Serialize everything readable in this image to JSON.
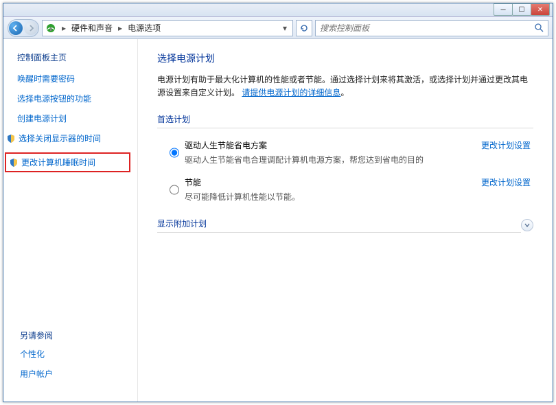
{
  "breadcrumb": {
    "seg1": "硬件和声音",
    "seg2": "电源选项"
  },
  "search": {
    "placeholder": "搜索控制面板"
  },
  "sidebar": {
    "title": "控制面板主页",
    "links": {
      "l0": "唤醒时需要密码",
      "l1": "选择电源按钮的功能",
      "l2": "创建电源计划",
      "l3": "选择关闭显示器的时间",
      "l4": "更改计算机睡眠时间"
    },
    "see_also": "另请参阅",
    "bottom": {
      "b0": "个性化",
      "b1": "用户帐户"
    }
  },
  "main": {
    "heading": "选择电源计划",
    "descr_pre": "电源计划有助于最大化计算机的性能或者节能。通过选择计划来将其激活，或选择计划并通过更改其电源设置来自定义计划。",
    "descr_link": "请提供电源计划的详细信息",
    "section_primary": "首选计划",
    "plans": [
      {
        "name": "驱动人生节能省电方案",
        "desc": "驱动人生节能省电合理调配计算机电源方案，帮您达到省电的目的",
        "action": "更改计划设置",
        "checked": true
      },
      {
        "name": "节能",
        "desc": "尽可能降低计算机性能以节能。",
        "action": "更改计划设置",
        "checked": false
      }
    ],
    "section_additional": "显示附加计划"
  }
}
